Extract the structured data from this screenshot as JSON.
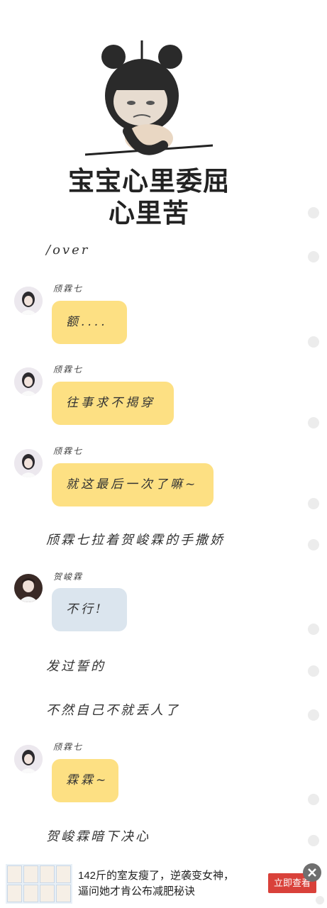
{
  "meme": {
    "caption_line1": "宝宝心里委屈",
    "caption_line2": "心里苦"
  },
  "messages": [
    {
      "kind": "narration",
      "text": "/over"
    },
    {
      "kind": "chat",
      "sender": "颀霖七",
      "text": "额....",
      "bubble_color": "#fde083"
    },
    {
      "kind": "chat",
      "sender": "颀霖七",
      "text": "往事求不揭穿",
      "bubble_color": "#fde083"
    },
    {
      "kind": "chat",
      "sender": "颀霖七",
      "text": "就这最后一次了嘛~",
      "bubble_color": "#fde083"
    },
    {
      "kind": "narration",
      "text": "颀霖七拉着贺峻霖的手撒娇"
    },
    {
      "kind": "chat",
      "sender": "贺峻霖",
      "text": "不行!",
      "bubble_color": "#dbe5ee"
    },
    {
      "kind": "narration",
      "text": "发过誓的"
    },
    {
      "kind": "narration",
      "text": "不然自己不就丢人了"
    },
    {
      "kind": "chat",
      "sender": "颀霖七",
      "text": "霖霖~",
      "bubble_color": "#fde083"
    },
    {
      "kind": "narration",
      "text": "贺峻霖暗下决心"
    }
  ],
  "ad": {
    "headline_line1": "142斤的室友瘦了，逆袭变女神，",
    "headline_line2": "逼问她才肯公布减肥秘诀",
    "cta_label": "立即查看",
    "close_icon": "close-icon"
  },
  "colors": {
    "bubble_yellow": "#fde083",
    "bubble_blue": "#dbe5ee",
    "cta_red": "#d9413a"
  }
}
